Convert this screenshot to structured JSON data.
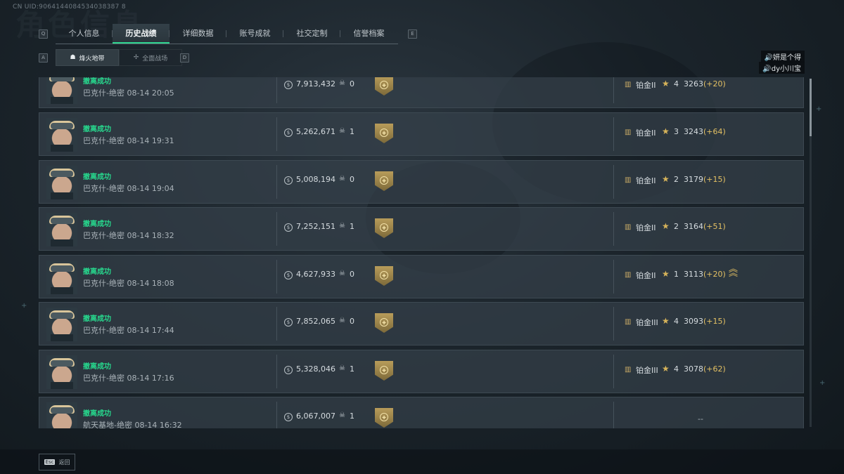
{
  "uid": "CN UID:9064144084534038387 8",
  "watermark": "角色信息",
  "tabs": {
    "key_left": "Q",
    "key_right": "E",
    "items": [
      {
        "label": "个人信息"
      },
      {
        "label": "历史战绩"
      },
      {
        "label": "详细数据"
      },
      {
        "label": "账号成就"
      },
      {
        "label": "社交定制"
      },
      {
        "label": "信誉档案"
      }
    ]
  },
  "subtabs": {
    "key_left": "A",
    "key_right": "D",
    "items": [
      {
        "label": "烽火地带",
        "icon": "fire-zone-icon"
      },
      {
        "label": "全面战场",
        "icon": "battlefield-icon"
      }
    ]
  },
  "chat": [
    {
      "text": "🔊妍是个得"
    },
    {
      "text": "🔊dy小川宝"
    }
  ],
  "records": [
    {
      "status": "撤离成功",
      "map": "巴克什-绝密 08-14 20:05",
      "value": "7,913,432",
      "kills": "0",
      "rank": "铂金II",
      "stars": "4",
      "score": "3263",
      "delta": "(+20)",
      "promo": false
    },
    {
      "status": "撤离成功",
      "map": "巴克什-绝密 08-14 19:31",
      "value": "5,262,671",
      "kills": "1",
      "rank": "铂金II",
      "stars": "3",
      "score": "3243",
      "delta": "(+64)",
      "promo": false
    },
    {
      "status": "撤离成功",
      "map": "巴克什-绝密 08-14 19:04",
      "value": "5,008,194",
      "kills": "0",
      "rank": "铂金II",
      "stars": "2",
      "score": "3179",
      "delta": "(+15)",
      "promo": false
    },
    {
      "status": "撤离成功",
      "map": "巴克什-绝密 08-14 18:32",
      "value": "7,252,151",
      "kills": "1",
      "rank": "铂金II",
      "stars": "2",
      "score": "3164",
      "delta": "(+51)",
      "promo": false
    },
    {
      "status": "撤离成功",
      "map": "巴克什-绝密 08-14 18:08",
      "value": "4,627,933",
      "kills": "0",
      "rank": "铂金II",
      "stars": "1",
      "score": "3113",
      "delta": "(+20)",
      "promo": true
    },
    {
      "status": "撤离成功",
      "map": "巴克什-绝密 08-14 17:44",
      "value": "7,852,065",
      "kills": "0",
      "rank": "铂金III",
      "stars": "4",
      "score": "3093",
      "delta": "(+15)",
      "promo": false
    },
    {
      "status": "撤离成功",
      "map": "巴克什-绝密 08-14 17:16",
      "value": "5,328,046",
      "kills": "1",
      "rank": "铂金III",
      "stars": "4",
      "score": "3078",
      "delta": "(+62)",
      "promo": false
    },
    {
      "status": "撤离成功",
      "map": "航天基地-绝密 08-14 16:32",
      "value": "6,067,007",
      "kills": "1",
      "rank": "",
      "stars": "",
      "score": "",
      "delta": "",
      "dash": "--",
      "promo": false
    }
  ],
  "footer": {
    "esc_key": "Esc",
    "back_label": "返回"
  },
  "colors": {
    "accent_green": "#27d98e",
    "gold": "#e3c063",
    "row_bg": "#34404a"
  }
}
